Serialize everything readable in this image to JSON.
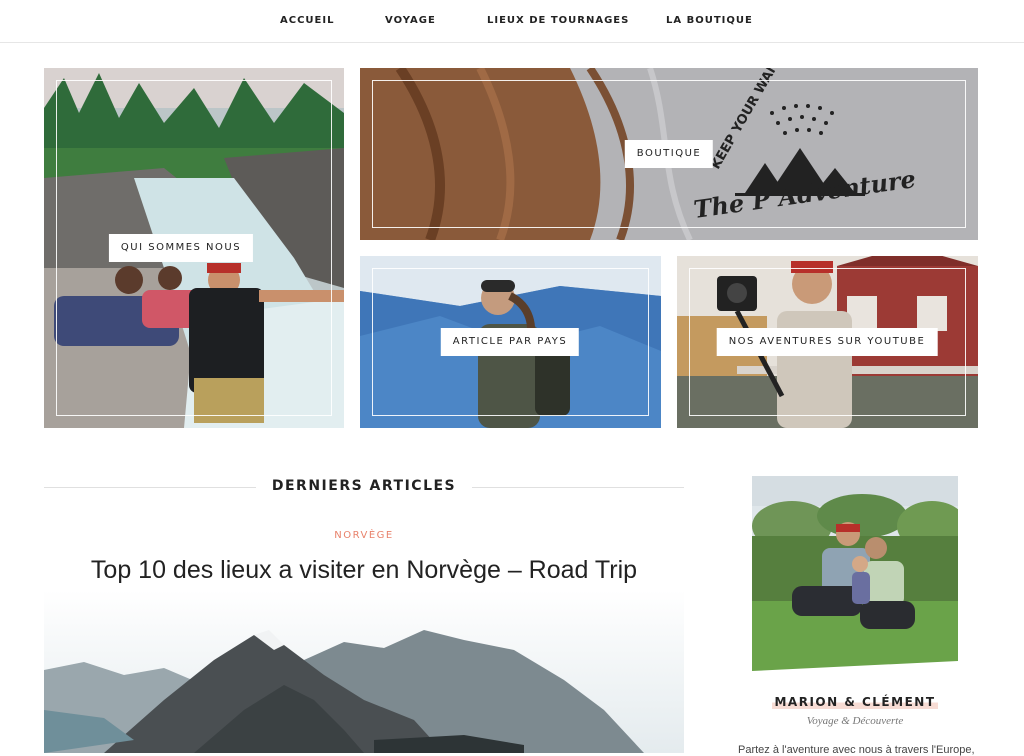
{
  "nav": {
    "items": [
      "ACCUEIL",
      "VOYAGE",
      "LIEUX DE TOURNAGES",
      "LA BOUTIQUE"
    ]
  },
  "tiles": {
    "about": "QUI SOMMES NOUS",
    "shop": "BOUTIQUE",
    "shop_print": {
      "arc_text": "KEEP YOUR WANDERLUST",
      "script_text": "The P Adventure"
    },
    "country": "ARTICLE PAR PAYS",
    "youtube": "NOS AVENTURES SUR YOUTUBE"
  },
  "latest": {
    "heading": "DERNIERS ARTICLES",
    "category": "NORVÈGE",
    "title": "Top 10 des lieux a visiter en Norvège – Road Trip"
  },
  "sidebar": {
    "name": "MARION & CLÉMENT",
    "subtitle": "Voyage & Découverte",
    "text": "Partez à l'aventure avec nous à travers l'Europe, à"
  },
  "colors": {
    "accent": "#e8826b",
    "highlight": "#f7dcd4"
  }
}
